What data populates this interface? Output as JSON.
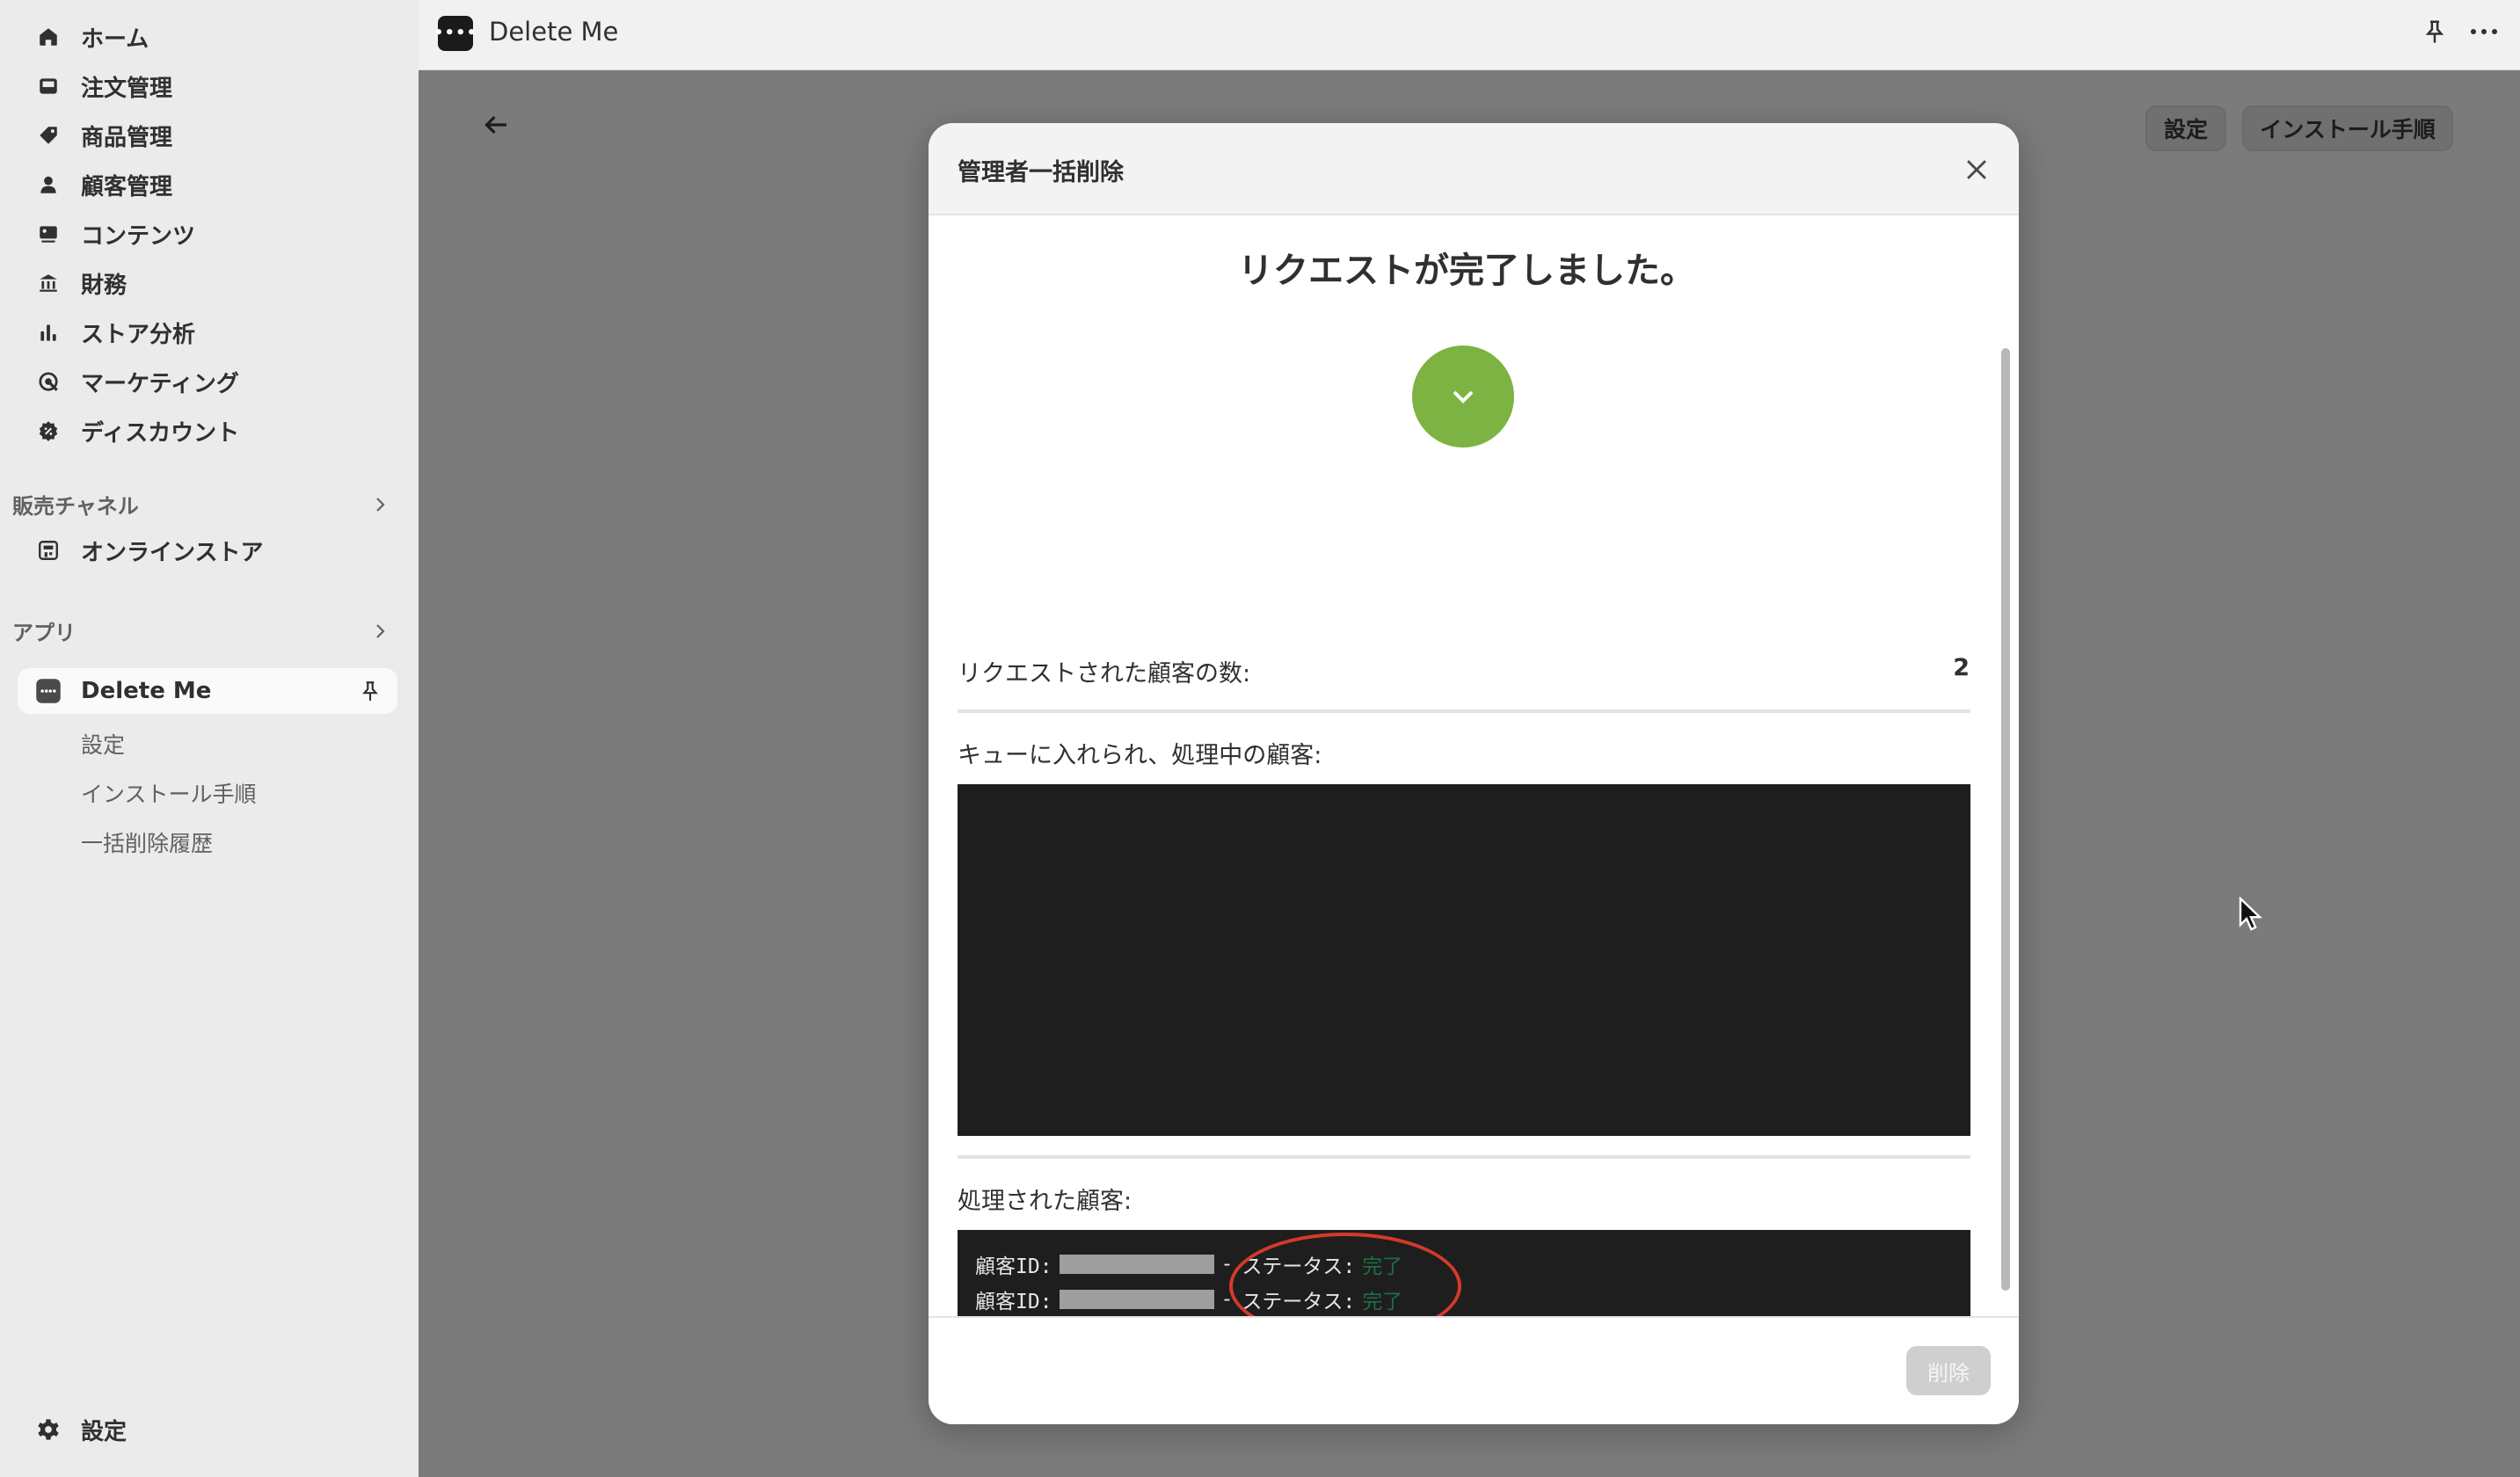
{
  "sidebar": {
    "items": [
      {
        "label": "ホーム",
        "icon": "home-icon"
      },
      {
        "label": "注文管理",
        "icon": "inbox-icon"
      },
      {
        "label": "商品管理",
        "icon": "tag-icon"
      },
      {
        "label": "顧客管理",
        "icon": "person-icon"
      },
      {
        "label": "コンテンツ",
        "icon": "image-icon"
      },
      {
        "label": "財務",
        "icon": "bank-icon"
      },
      {
        "label": "ストア分析",
        "icon": "bar-chart-icon"
      },
      {
        "label": "マーケティング",
        "icon": "target-icon"
      },
      {
        "label": "ディスカウント",
        "icon": "discount-icon"
      }
    ],
    "sales_channels_heading": "販売チャネル",
    "online_store": "オンラインストア",
    "apps_heading": "アプリ",
    "active_app": "Delete Me",
    "app_sub_items": [
      "設定",
      "インストール手順",
      "一括削除履歴"
    ],
    "settings": "設定"
  },
  "topbar": {
    "app_logo_text": "••••",
    "title": "Delete Me"
  },
  "main": {
    "settings_button": "設定",
    "install_button": "インストール手順"
  },
  "modal": {
    "title": "管理者一括削除",
    "heading": "リクエストが完了しました。",
    "requested_label": "リクエストされた顧客の数:",
    "requested_count": "2",
    "queued_label": "キューに入れられ、処理中の顧客:",
    "processed_label": "処理された顧客:",
    "processed_lines": [
      {
        "prefix": "顧客ID:",
        "sep": "-",
        "status_label": "ステータス:",
        "status": "完了"
      },
      {
        "prefix": "顧客ID:",
        "sep": "-",
        "status_label": "ステータス:",
        "status": "完了"
      }
    ],
    "delete_button": "削除"
  },
  "colors": {
    "success_green": "#7cb342",
    "annotation_red": "#d33a2c",
    "console_bg": "#1e1e1e",
    "status_green": "#1f6e44"
  }
}
